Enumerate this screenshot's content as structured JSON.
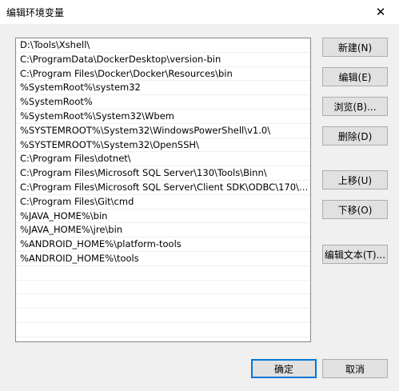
{
  "window": {
    "title": "编辑环境变量",
    "close_glyph": "✕"
  },
  "paths": [
    "D:\\Tools\\Xshell\\",
    "C:\\ProgramData\\DockerDesktop\\version-bin",
    "C:\\Program Files\\Docker\\Docker\\Resources\\bin",
    "%SystemRoot%\\system32",
    "%SystemRoot%",
    "%SystemRoot%\\System32\\Wbem",
    "%SYSTEMROOT%\\System32\\WindowsPowerShell\\v1.0\\",
    "%SYSTEMROOT%\\System32\\OpenSSH\\",
    "C:\\Program Files\\dotnet\\",
    "C:\\Program Files\\Microsoft SQL Server\\130\\Tools\\Binn\\",
    "C:\\Program Files\\Microsoft SQL Server\\Client SDK\\ODBC\\170\\Too...",
    "C:\\Program Files\\Git\\cmd",
    "%JAVA_HOME%\\bin",
    "%JAVA_HOME%\\jre\\bin",
    "%ANDROID_HOME%\\platform-tools",
    "%ANDROID_HOME%\\tools"
  ],
  "buttons": {
    "new": "新建(N)",
    "edit": "编辑(E)",
    "browse": "浏览(B)...",
    "delete": "删除(D)",
    "move_up": "上移(U)",
    "move_down": "下移(O)",
    "edit_text": "编辑文本(T)...",
    "ok": "确定",
    "cancel": "取消"
  }
}
